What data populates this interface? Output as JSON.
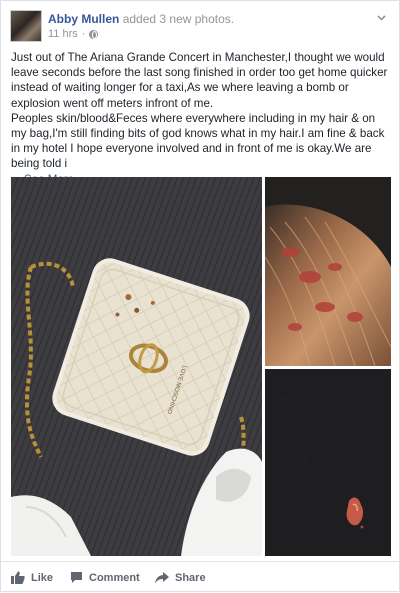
{
  "post": {
    "author": "Abby Mullen",
    "action": "added 3 new photos.",
    "time": "11 hrs",
    "separator": "·",
    "paragraph1": "Just out of The Ariana Grande Concert in Manchester,I thought we would leave seconds before the last song finished in order too get home quicker instead of waiting longer for a taxi,As we where leaving a bomb or explosion went off meters infront of me.",
    "paragraph2": "Peoples skin/blood&Feces where everywhere including in my hair & on my bag,I'm still finding bits of god knows what in my hair.I am fine & back in my hotel I hope everyone involved and in front of me is okay.We are being told i",
    "ellipsis": "...",
    "see_more": "See More"
  },
  "photos": {
    "bag_brand": "LOVE MOSCHINO"
  },
  "footer": {
    "like": "Like",
    "comment": "Comment",
    "share": "Share"
  },
  "icons": [
    "avatar",
    "globe-icon",
    "chevron-down-icon",
    "like-icon",
    "comment-icon",
    "share-icon"
  ],
  "colors": {
    "link": "#365899",
    "text": "#1d2129",
    "meta": "#90949c",
    "action": "#606770"
  }
}
